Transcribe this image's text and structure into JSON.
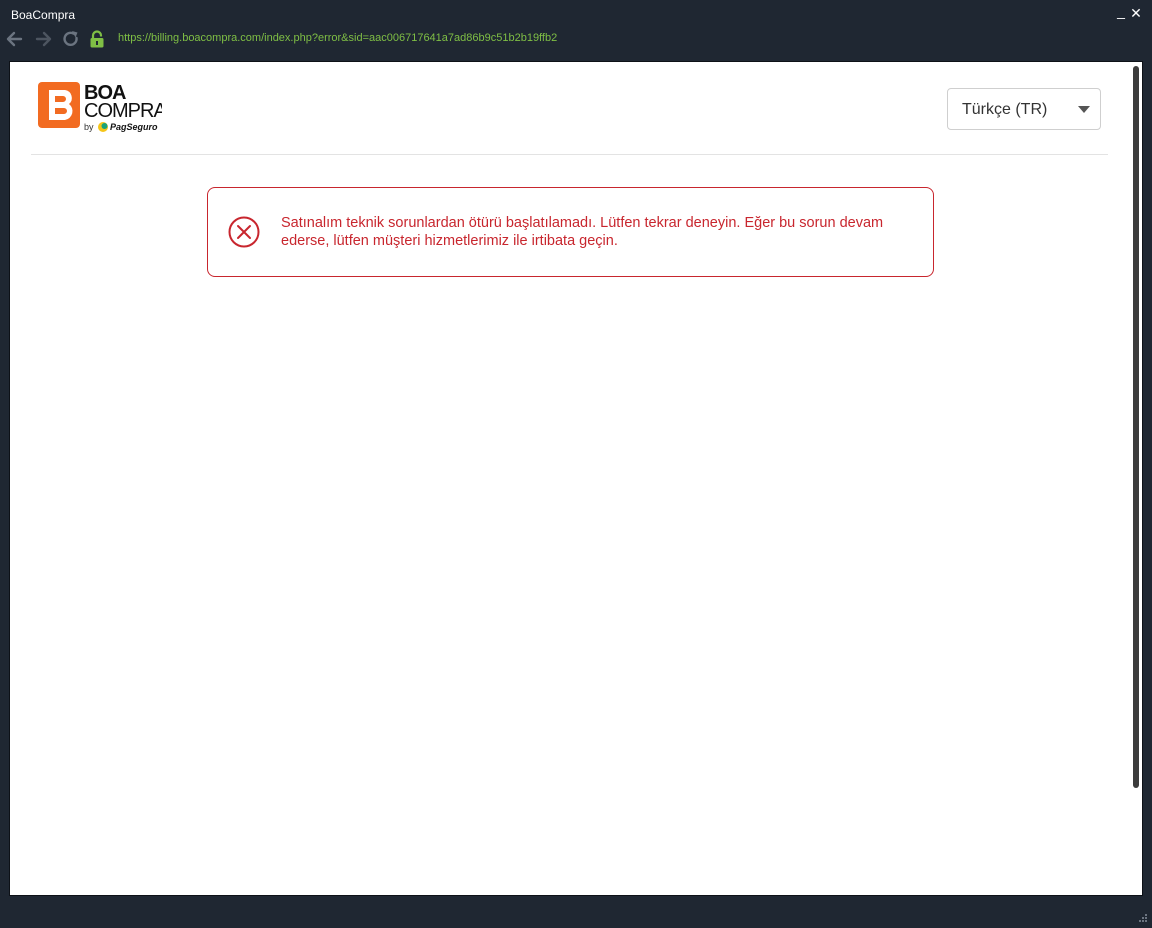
{
  "window": {
    "title": "BoaCompra",
    "minimize_label": "_",
    "close_label": "✕"
  },
  "navbar": {
    "url": "https://billing.boacompra.com/index.php?error&sid=aac006717641a7ad86b9c51b2b19ffb2",
    "url_color": "#7fbf45",
    "icons": [
      "back-arrow-icon",
      "forward-arrow-icon",
      "reload-icon",
      "lock-icon"
    ]
  },
  "header": {
    "logo": {
      "line1": "BOA",
      "line2": "COMPRA",
      "by": "by",
      "partner": "PagSeguro",
      "brand_color": "#f26b21"
    },
    "language_select": {
      "selected": "Türkçe (TR)"
    }
  },
  "error": {
    "message": "Satınalım teknik sorunlardan ötürü başlatılamadı. Lütfen tekrar deneyin. Eğer bu sorun devam ederse, lütfen müşteri hizmetlerimiz ile irtibata geçin.",
    "color": "#c8262e",
    "icon": "error-circle-x-icon"
  }
}
